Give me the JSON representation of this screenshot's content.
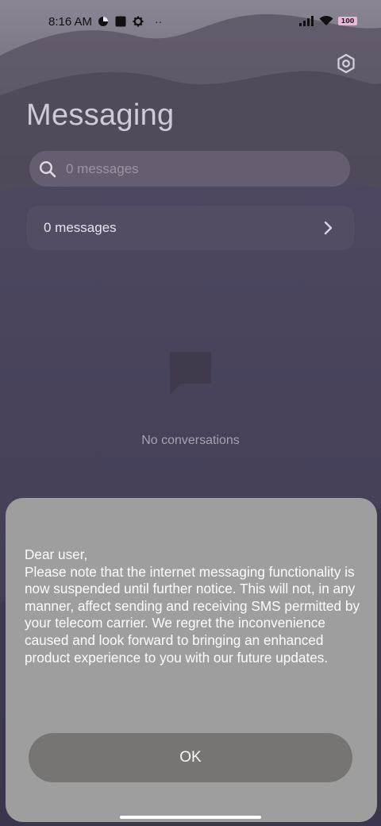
{
  "status_bar": {
    "time": "8:16 AM",
    "battery": "100",
    "more_indicator": "··"
  },
  "header": {
    "title": "Messaging",
    "settings_icon": "gear-hexagon-icon"
  },
  "search": {
    "placeholder": "0 messages",
    "icon": "search-icon"
  },
  "messages_row": {
    "label": "0 messages",
    "icon": "chevron-right-icon"
  },
  "empty_state": {
    "icon": "chat-bubble-icon",
    "text": "No conversations"
  },
  "dialog": {
    "message": "Dear user,\nPlease note that the internet messaging functionality is now suspended until further notice. This will not, in any manner, affect sending and receiving SMS permitted by your telecom carrier. We regret the inconvenience caused and look forward to bringing an enhanced product experience to you with our future updates.",
    "ok_label": "OK"
  },
  "colors": {
    "background": "#4b4560",
    "dialog": "#9e9e9e",
    "ok_button": "#777574",
    "battery": "#e8b8d6"
  }
}
